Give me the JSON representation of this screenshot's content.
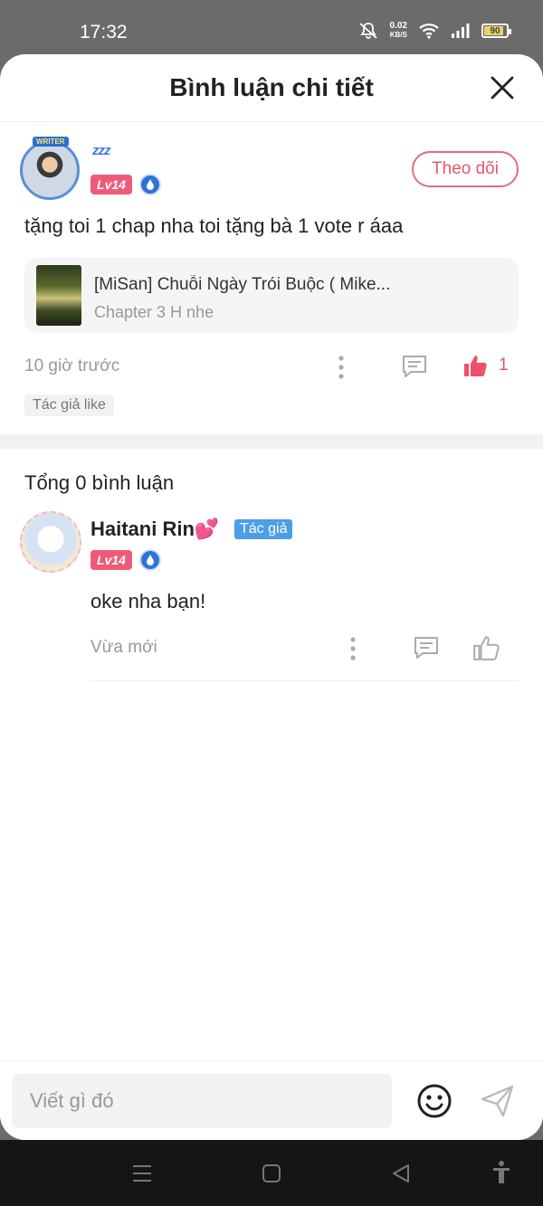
{
  "status_bar": {
    "time": "17:32",
    "net_speed_value": "0.02",
    "net_speed_unit": "KB/S",
    "battery": "90"
  },
  "sheet": {
    "title": "Bình luận chi tiết"
  },
  "main_comment": {
    "avatar_frame_label": "WRITER",
    "status_emoji": "zzz",
    "level": "Lv14",
    "follow_label": "Theo dõi",
    "text": "tặng toi 1 chap nha toi tặng bà 1 vote r áaa",
    "story": {
      "title": "[MiSan] Chuỗi Ngày Trói Buộc ( Mike...",
      "chapter": "Chapter 3 H nhe"
    },
    "time": "10 giờ trước",
    "like_count": "1",
    "author_like_tag": "Tác giả like"
  },
  "total_label": "Tổng 0 bình luận",
  "reply": {
    "name": "Haitani Rin",
    "name_emoji": "💕",
    "author_tag": "Tác giả",
    "level": "Lv14",
    "text": "oke nha bạn!",
    "time": "Vừa mới"
  },
  "input": {
    "placeholder": "Viết gì đó"
  },
  "colors": {
    "accent": "#e2576c",
    "level_badge": "#f05a7a",
    "author_tag": "#4d9ee8",
    "muted_text": "#999999"
  }
}
